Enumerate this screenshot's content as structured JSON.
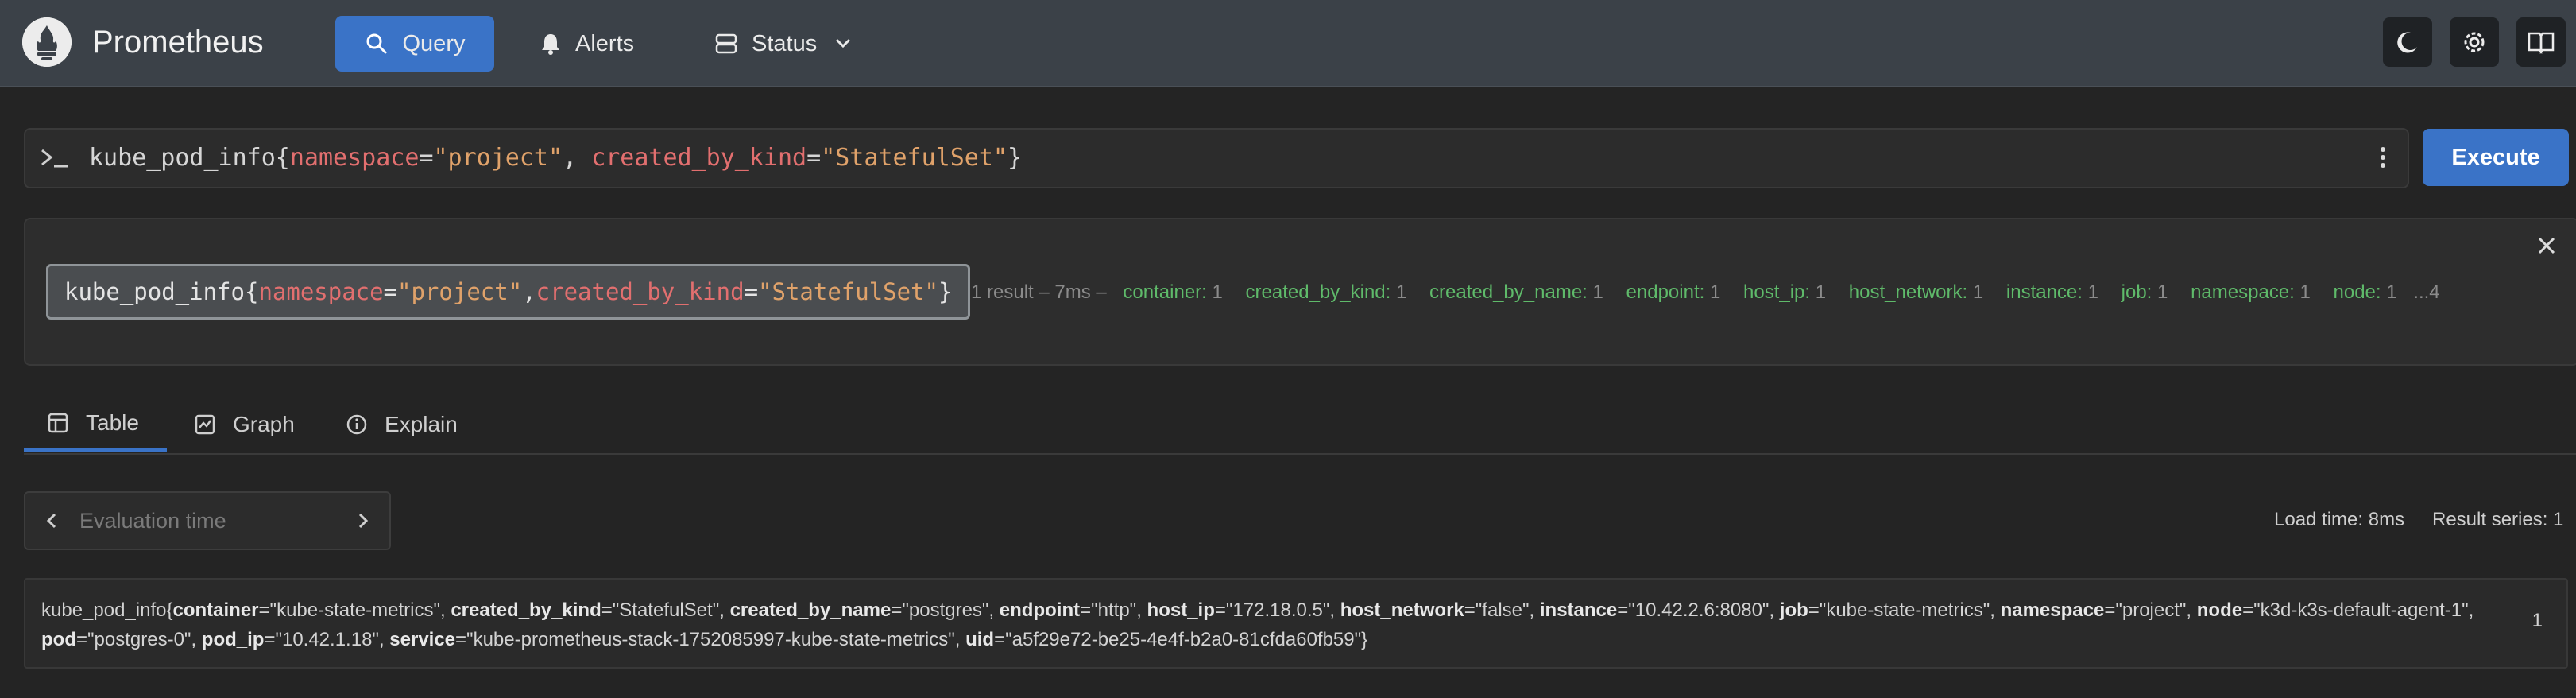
{
  "app": {
    "name": "Prometheus"
  },
  "nav": {
    "query": "Query",
    "alerts": "Alerts",
    "status": "Status"
  },
  "query": {
    "metric": "kube_pod_info",
    "display_parts": [
      "kube_pod_info{",
      "namespace",
      "=",
      "\"project\"",
      ", ",
      "created_by_kind",
      "=",
      "\"StatefulSet\"",
      "}"
    ],
    "execute_label": "Execute"
  },
  "tree": {
    "node_parts": [
      "kube_pod_info{",
      "namespace",
      "=",
      "\"project\"",
      ",",
      "created_by_kind",
      "=",
      "\"StatefulSet\"",
      "}"
    ],
    "summary": "1 result – 7ms –",
    "labels": [
      {
        "name": "container:",
        "count": "1"
      },
      {
        "name": "created_by_kind:",
        "count": "1"
      },
      {
        "name": "created_by_name:",
        "count": "1"
      },
      {
        "name": "endpoint:",
        "count": "1"
      },
      {
        "name": "host_ip:",
        "count": "1"
      },
      {
        "name": "host_network:",
        "count": "1"
      },
      {
        "name": "instance:",
        "count": "1"
      },
      {
        "name": "job:",
        "count": "1"
      },
      {
        "name": "namespace:",
        "count": "1"
      },
      {
        "name": "node:",
        "count": "1"
      }
    ],
    "more": "...4"
  },
  "tabs": {
    "table": "Table",
    "graph": "Graph",
    "explain": "Explain",
    "active": "table"
  },
  "eval": {
    "placeholder": "Evaluation time"
  },
  "meta": {
    "load_time": "Load time: 8ms",
    "result_series": "Result series: 1"
  },
  "result": {
    "metric": "kube_pod_info",
    "labels": [
      {
        "k": "container",
        "v": "\"kube-state-metrics\""
      },
      {
        "k": "created_by_kind",
        "v": "\"StatefulSet\""
      },
      {
        "k": "created_by_name",
        "v": "\"postgres\""
      },
      {
        "k": "endpoint",
        "v": "\"http\""
      },
      {
        "k": "host_ip",
        "v": "\"172.18.0.5\""
      },
      {
        "k": "host_network",
        "v": "\"false\""
      },
      {
        "k": "instance",
        "v": "\"10.42.2.6:8080\""
      },
      {
        "k": "job",
        "v": "\"kube-state-metrics\""
      },
      {
        "k": "namespace",
        "v": "\"project\""
      },
      {
        "k": "node",
        "v": "\"k3d-k3s-default-agent-1\""
      },
      {
        "k": "pod",
        "v": "\"postgres-0\""
      },
      {
        "k": "pod_ip",
        "v": "\"10.42.1.18\""
      },
      {
        "k": "service",
        "v": "\"kube-prometheus-stack-1752085997-kube-state-metrics\""
      },
      {
        "k": "uid",
        "v": "\"a5f29e72-be25-4e4f-b2a0-81cfda60fb59\""
      }
    ],
    "value": "1"
  },
  "colors": {
    "accent": "#3a73c7",
    "label_green": "#5fba6a",
    "key_red": "#e26f6f",
    "value_orange": "#e0a26a"
  }
}
